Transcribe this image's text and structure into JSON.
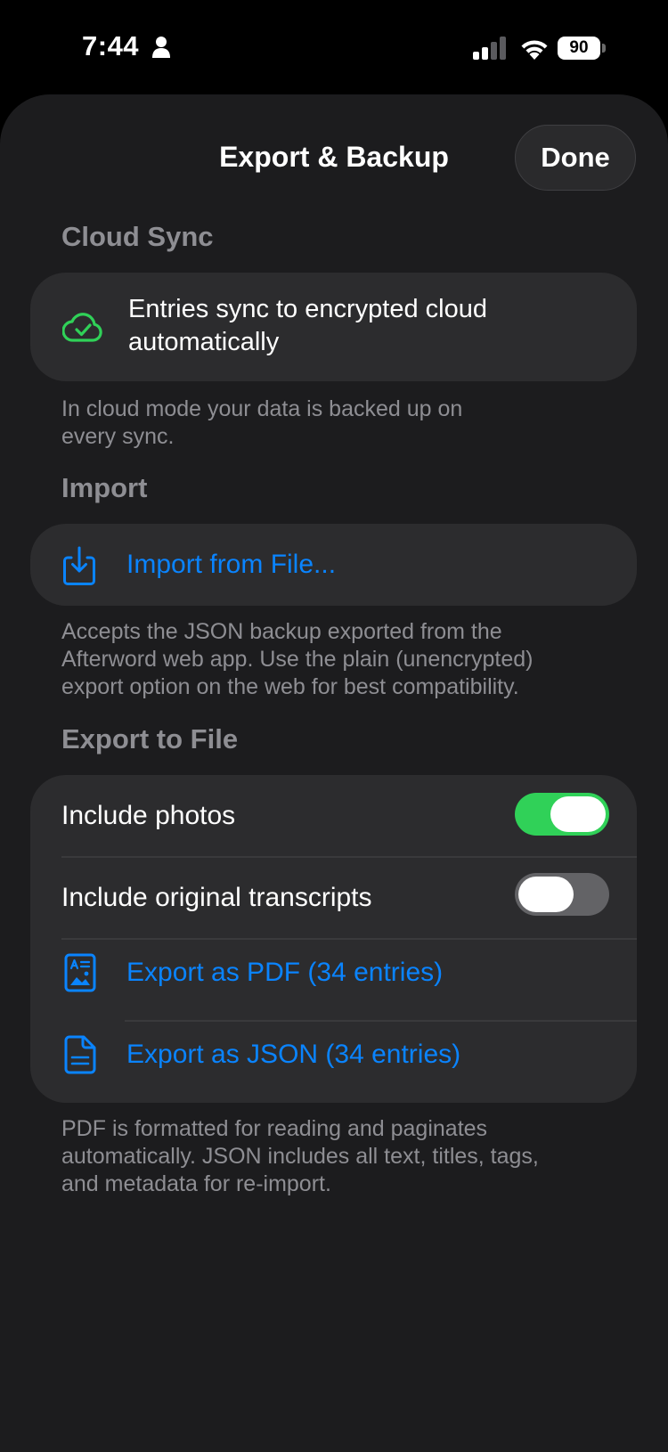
{
  "status_bar": {
    "time": "7:44",
    "battery": "90",
    "icons": [
      "person-icon",
      "cellular-signal-icon",
      "wifi-icon",
      "battery-icon"
    ]
  },
  "sheet": {
    "title": "Export & Backup",
    "done_label": "Done"
  },
  "cloud_sync": {
    "header": "Cloud Sync",
    "row_line1": "Entries sync to encrypted cloud",
    "row_line2": "automatically",
    "row_icon": "cloud-check-icon",
    "footer_line1": "In cloud mode your data is backed up on",
    "footer_line2": "every sync."
  },
  "import": {
    "header": "Import",
    "row_label": "Import from File...",
    "row_icon": "import-file-icon",
    "footer_line1": "Accepts the JSON backup exported from the",
    "footer_line2": "Afterword web app. Use the plain (unencrypted)",
    "footer_line3": "export option on the web for best compatibility."
  },
  "export": {
    "header": "Export to File",
    "include_photos_label": "Include photos",
    "include_photos_on": true,
    "include_transcripts_label": "Include original transcripts",
    "include_transcripts_on": false,
    "export_pdf_label": "Export as PDF (34 entries)",
    "export_pdf_icon": "pdf-document-icon",
    "export_json_label": "Export as JSON (34 entries)",
    "export_json_icon": "json-document-icon",
    "footer_line1": "PDF is formatted for reading and paginates",
    "footer_line2": "automatically. JSON includes all text, titles, tags,",
    "footer_line3": "and metadata for re-import."
  },
  "colors": {
    "accent_blue": "#0a84ff",
    "toggle_on": "#30d158",
    "toggle_off": "#636366",
    "cloud_icon": "#30d158",
    "sheet_background": "#1c1c1e",
    "card_background": "#2c2c2e"
  }
}
